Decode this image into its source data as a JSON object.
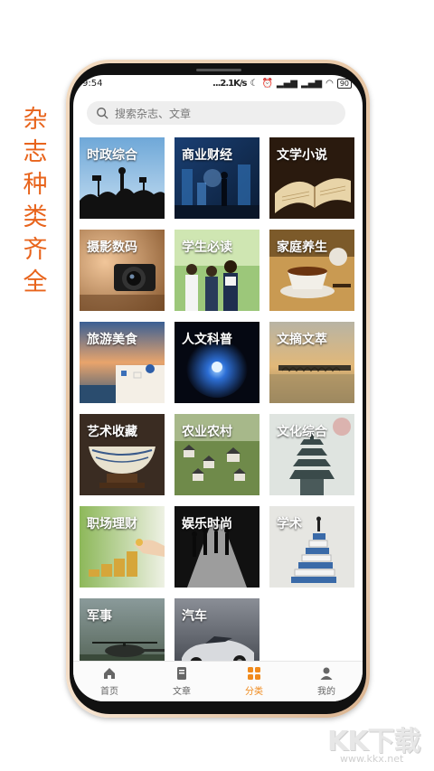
{
  "side_title": [
    "杂",
    "志",
    "种",
    "类",
    "齐",
    "全"
  ],
  "status_bar": {
    "time": "9:54",
    "speed": "...2.1K/s",
    "battery": "90"
  },
  "search": {
    "placeholder": "搜索杂志、文章"
  },
  "categories": [
    {
      "label": "时政综合",
      "icon": "crowd-silhouette"
    },
    {
      "label": "商业财经",
      "icon": "businessman-city"
    },
    {
      "label": "文学小说",
      "icon": "open-book"
    },
    {
      "label": "摄影数码",
      "icon": "camera"
    },
    {
      "label": "学生必读",
      "icon": "students"
    },
    {
      "label": "家庭养生",
      "icon": "tea-cup"
    },
    {
      "label": "旅游美食",
      "icon": "coastal-town"
    },
    {
      "label": "人文科普",
      "icon": "glowing-orb"
    },
    {
      "label": "文摘文萃",
      "icon": "bridge-sunset"
    },
    {
      "label": "艺术收藏",
      "icon": "antique-bowl"
    },
    {
      "label": "农业农村",
      "icon": "village"
    },
    {
      "label": "文化综合",
      "icon": "pagoda"
    },
    {
      "label": "职场理财",
      "icon": "coins"
    },
    {
      "label": "娱乐时尚",
      "icon": "runway"
    },
    {
      "label": "学术",
      "icon": "book-stack"
    },
    {
      "label": "军事",
      "icon": "helicopter"
    },
    {
      "label": "汽车",
      "icon": "sports-car"
    }
  ],
  "bottom_nav": [
    {
      "label": "首页",
      "icon": "home-icon"
    },
    {
      "label": "文章",
      "icon": "article-icon"
    },
    {
      "label": "分类",
      "icon": "category-icon",
      "active": true
    },
    {
      "label": "我的",
      "icon": "profile-icon"
    }
  ],
  "colors": {
    "accent": "#f08a1c",
    "side_title": "#e8641c"
  },
  "watermark": {
    "big": "KK下载",
    "small": "www.kkx.net"
  }
}
